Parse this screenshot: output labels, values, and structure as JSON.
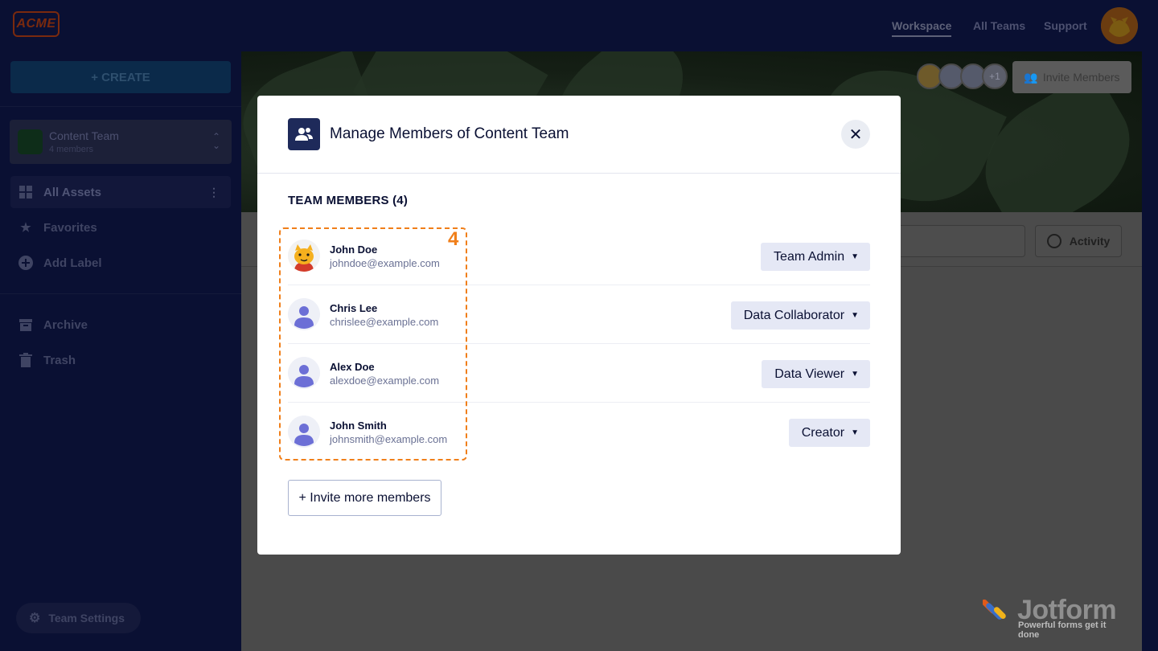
{
  "topbar": {
    "logo": "ACME",
    "nav": [
      "Workspace",
      "All Teams",
      "Support"
    ]
  },
  "sidebar": {
    "create_label": "+ CREATE",
    "team": {
      "name": "Content Team",
      "count": "4 members"
    },
    "items": [
      {
        "label": "All Assets",
        "icon": "grid-icon"
      },
      {
        "label": "Favorites",
        "icon": "star-icon"
      },
      {
        "label": "Add Label",
        "icon": "plus-circle-icon"
      }
    ],
    "items2": [
      {
        "label": "Archive",
        "icon": "archive-icon"
      },
      {
        "label": "Trash",
        "icon": "trash-icon"
      }
    ],
    "team_settings": "Team Settings"
  },
  "main": {
    "invite_members": "Invite Members",
    "avatar_extra": "+1",
    "activity": "Activity",
    "brand": {
      "name": "Jotform",
      "tagline": "Powerful forms get it done"
    }
  },
  "modal": {
    "title": "Manage Members of Content Team",
    "section_title": "TEAM MEMBERS (4)",
    "members": [
      {
        "name": "John Doe",
        "email": "johndoe@example.com",
        "role": "Team Admin"
      },
      {
        "name": "Chris Lee",
        "email": "chrislee@example.com",
        "role": "Data Collaborator"
      },
      {
        "name": "Alex Doe",
        "email": "alexdoe@example.com",
        "role": "Data Viewer"
      },
      {
        "name": "John Smith",
        "email": "johnsmith@example.com",
        "role": "Creator"
      }
    ],
    "invite_more": "+ Invite more members",
    "highlight_number": "4"
  },
  "colors": {
    "brand_navy": "#0a1033",
    "highlight_orange": "#f07f1a",
    "role_button_bg": "#e5e8f5",
    "avatar_purple": "#6c6fd6"
  }
}
